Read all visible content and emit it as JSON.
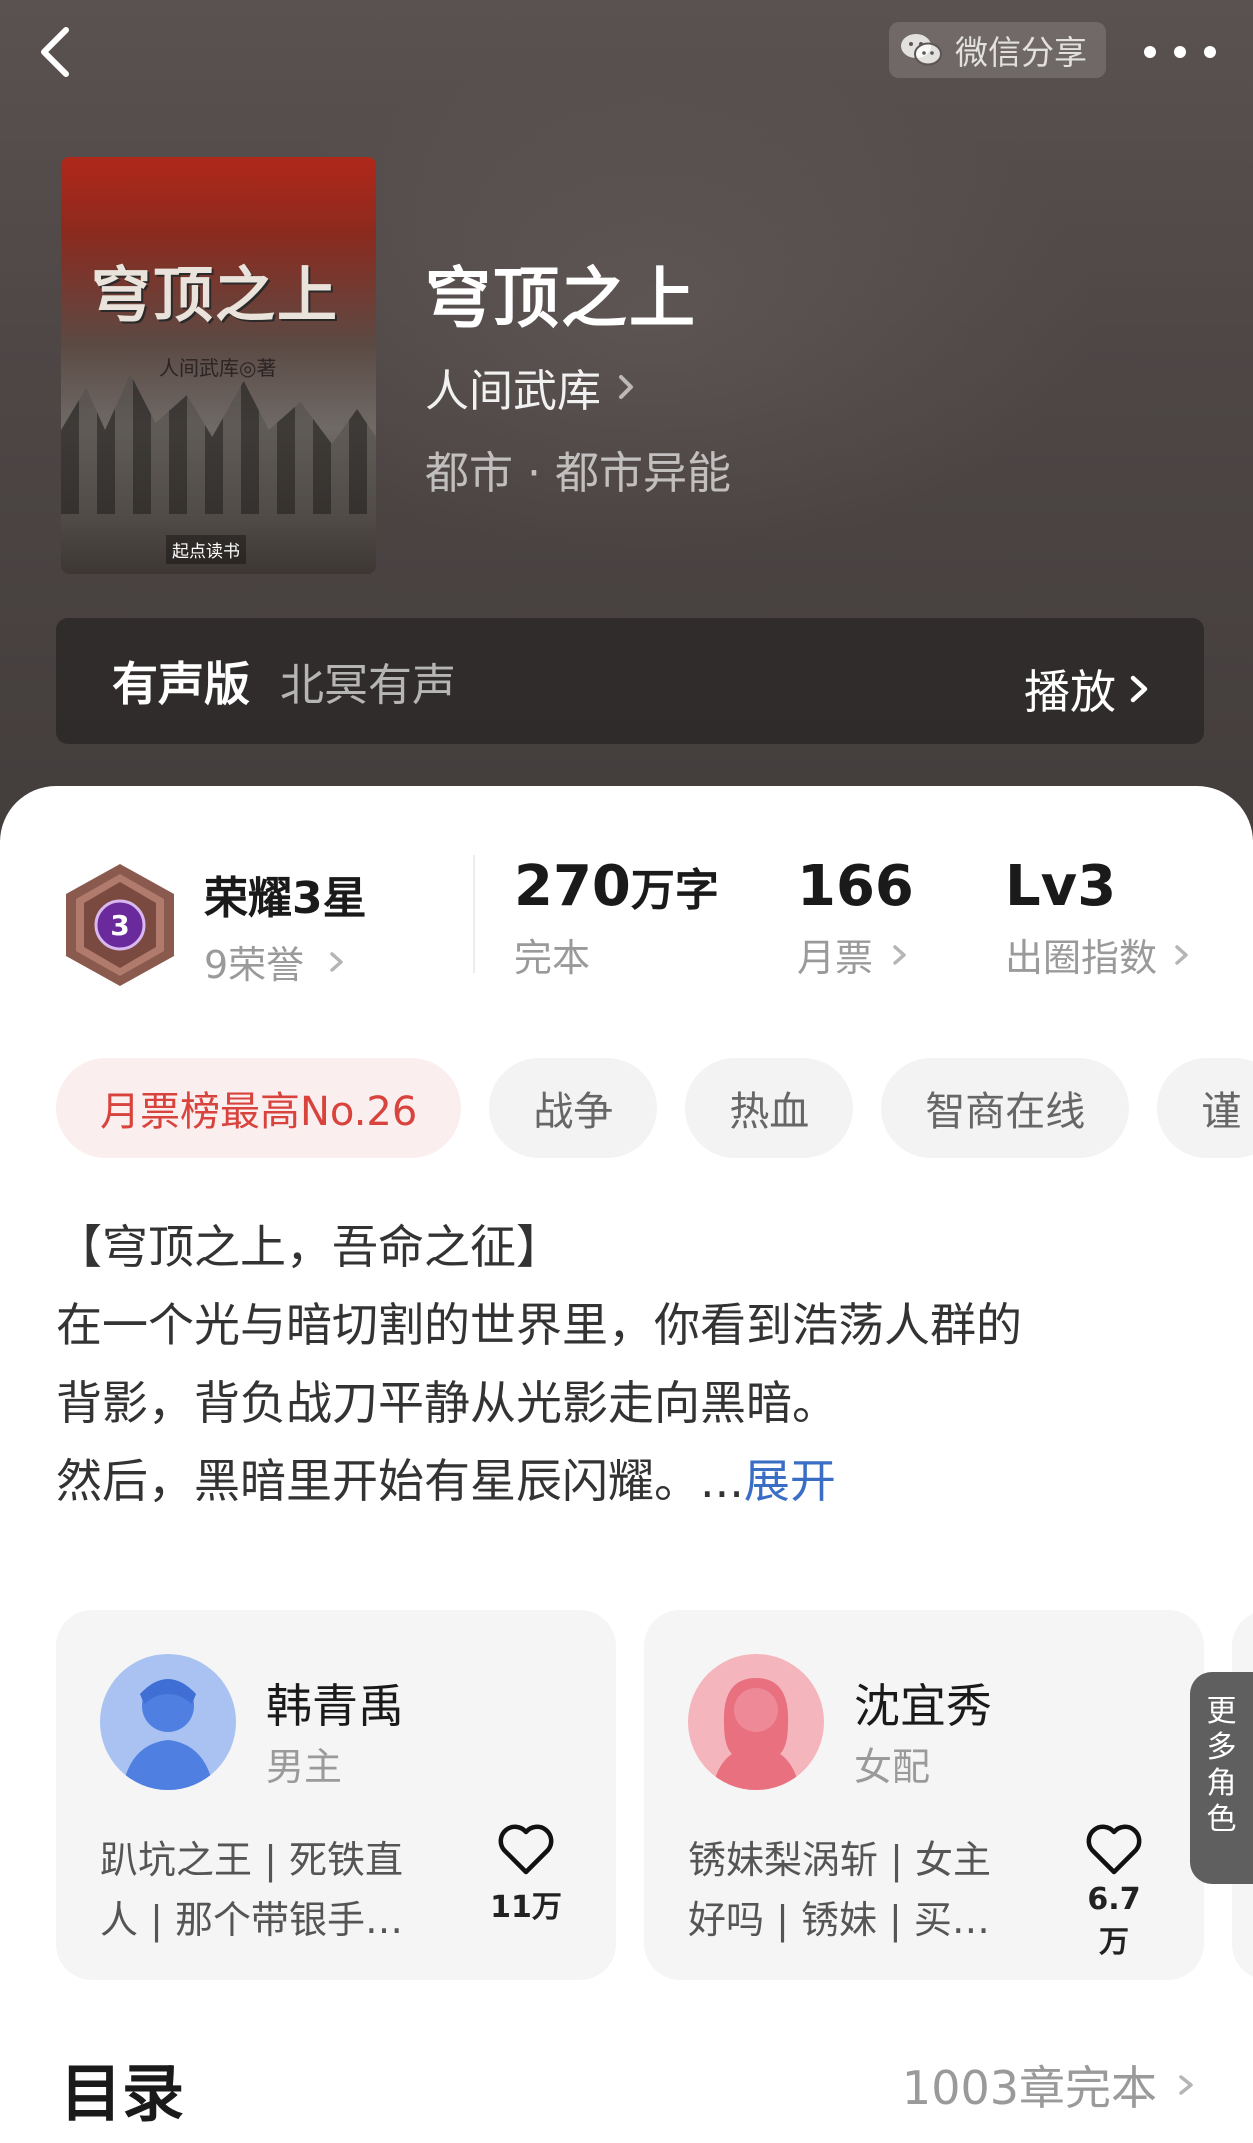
{
  "header": {
    "share_label": "微信分享"
  },
  "book": {
    "title": "穹顶之上",
    "author": "人间武库",
    "genre": "都市 · 都市异能",
    "cover": {
      "title": "穹顶之上",
      "author": "人间武库◎著",
      "publisher": "起点读书"
    }
  },
  "audio": {
    "tag": "有声版",
    "studio": "北冥有声",
    "play_label": "播放"
  },
  "stats": {
    "honor_title": "荣耀3星",
    "honor_badge_number": "3",
    "honor_sub": "9荣誉",
    "words_value": "270",
    "words_unit": "万字",
    "words_sub": "完本",
    "tickets_value": "166",
    "tickets_sub": "月票",
    "index_value": "Lv3",
    "index_sub": "出圈指数"
  },
  "tags": [
    "月票榜最高No.26",
    "战争",
    "热血",
    "智商在线",
    "谨"
  ],
  "description": {
    "lines": [
      "【穹顶之上，吾命之征】",
      "在一个光与暗切割的世界里，你看到浩荡人群的",
      "背影，背负战刀平静从光影走向黑暗。",
      "然后，黑暗里开始有星辰闪耀。..."
    ],
    "expand_label": "展开"
  },
  "roles": [
    {
      "name": "韩青禹",
      "type": "男主",
      "desc_lines": [
        "趴坑之王 | 死铁直",
        "人 | 那个带银手…"
      ],
      "likes": "11万"
    },
    {
      "name": "沈宜秀",
      "type": "女配",
      "desc_lines": [
        "锈妹梨涡斩 | 女主",
        "好吗 | 锈妹 | 买…"
      ],
      "likes": "6.7万"
    }
  ],
  "more_roles_label": [
    "更",
    "多",
    "角",
    "色"
  ],
  "toc": {
    "title": "目录",
    "meta": "1003章完本"
  },
  "colors": {
    "accent_link": "#3a6ec4",
    "rank_chip_text": "#d8433d",
    "badge_purple": "#6a2a9c"
  }
}
